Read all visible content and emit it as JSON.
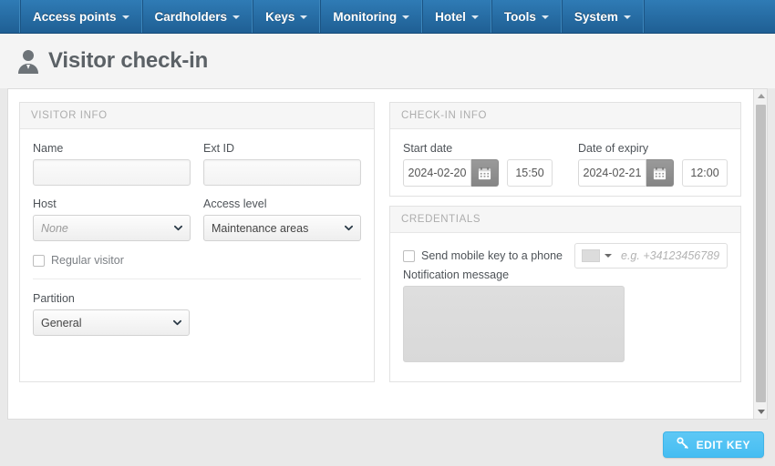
{
  "nav": {
    "items": [
      {
        "label": "Access points",
        "icon": "chevron-down-icon"
      },
      {
        "label": "Cardholders",
        "icon": "chevron-down-icon"
      },
      {
        "label": "Keys",
        "icon": "chevron-down-icon"
      },
      {
        "label": "Monitoring",
        "icon": "chevron-down-icon"
      },
      {
        "label": "Hotel",
        "icon": "chevron-down-icon"
      },
      {
        "label": "Tools",
        "icon": "chevron-down-icon"
      },
      {
        "label": "System",
        "icon": "chevron-down-icon"
      }
    ]
  },
  "header": {
    "title": "Visitor check-in",
    "icon": "user-icon"
  },
  "visitor_info": {
    "panel_title": "VISITOR INFO",
    "name": {
      "label": "Name",
      "value": "",
      "placeholder": ""
    },
    "ext_id": {
      "label": "Ext ID",
      "value": "",
      "placeholder": ""
    },
    "host": {
      "label": "Host",
      "value": "None"
    },
    "access_level": {
      "label": "Access level",
      "value": "Maintenance areas"
    },
    "regular_visitor": {
      "label": "Regular visitor",
      "checked": false
    },
    "partition": {
      "label": "Partition",
      "value": "General"
    }
  },
  "checkin_info": {
    "panel_title": "CHECK-IN INFO",
    "start_date": {
      "label": "Start date",
      "date": "2024-02-20",
      "time": "15:50",
      "calendar_icon": "calendar-icon"
    },
    "expiry_date": {
      "label": "Date of expiry",
      "date": "2024-02-21",
      "time": "12:00",
      "calendar_icon": "calendar-icon"
    }
  },
  "credentials": {
    "panel_title": "CREDENTIALS",
    "send_mobile_key": {
      "label": "Send mobile key to a phone",
      "checked": false
    },
    "phone": {
      "placeholder": "e.g. +34123456789",
      "value": "",
      "country_icon": "flag-icon"
    },
    "notification_message": {
      "label": "Notification message",
      "value": "",
      "disabled": true
    }
  },
  "footer": {
    "edit_key_label": "EDIT KEY",
    "edit_key_icon": "key-icon"
  },
  "colors": {
    "nav_blue": "#2f7bb5",
    "accent_button": "#45bdf2",
    "page_background": "#e9e9e9",
    "panel_header": "#f6f6f6"
  }
}
